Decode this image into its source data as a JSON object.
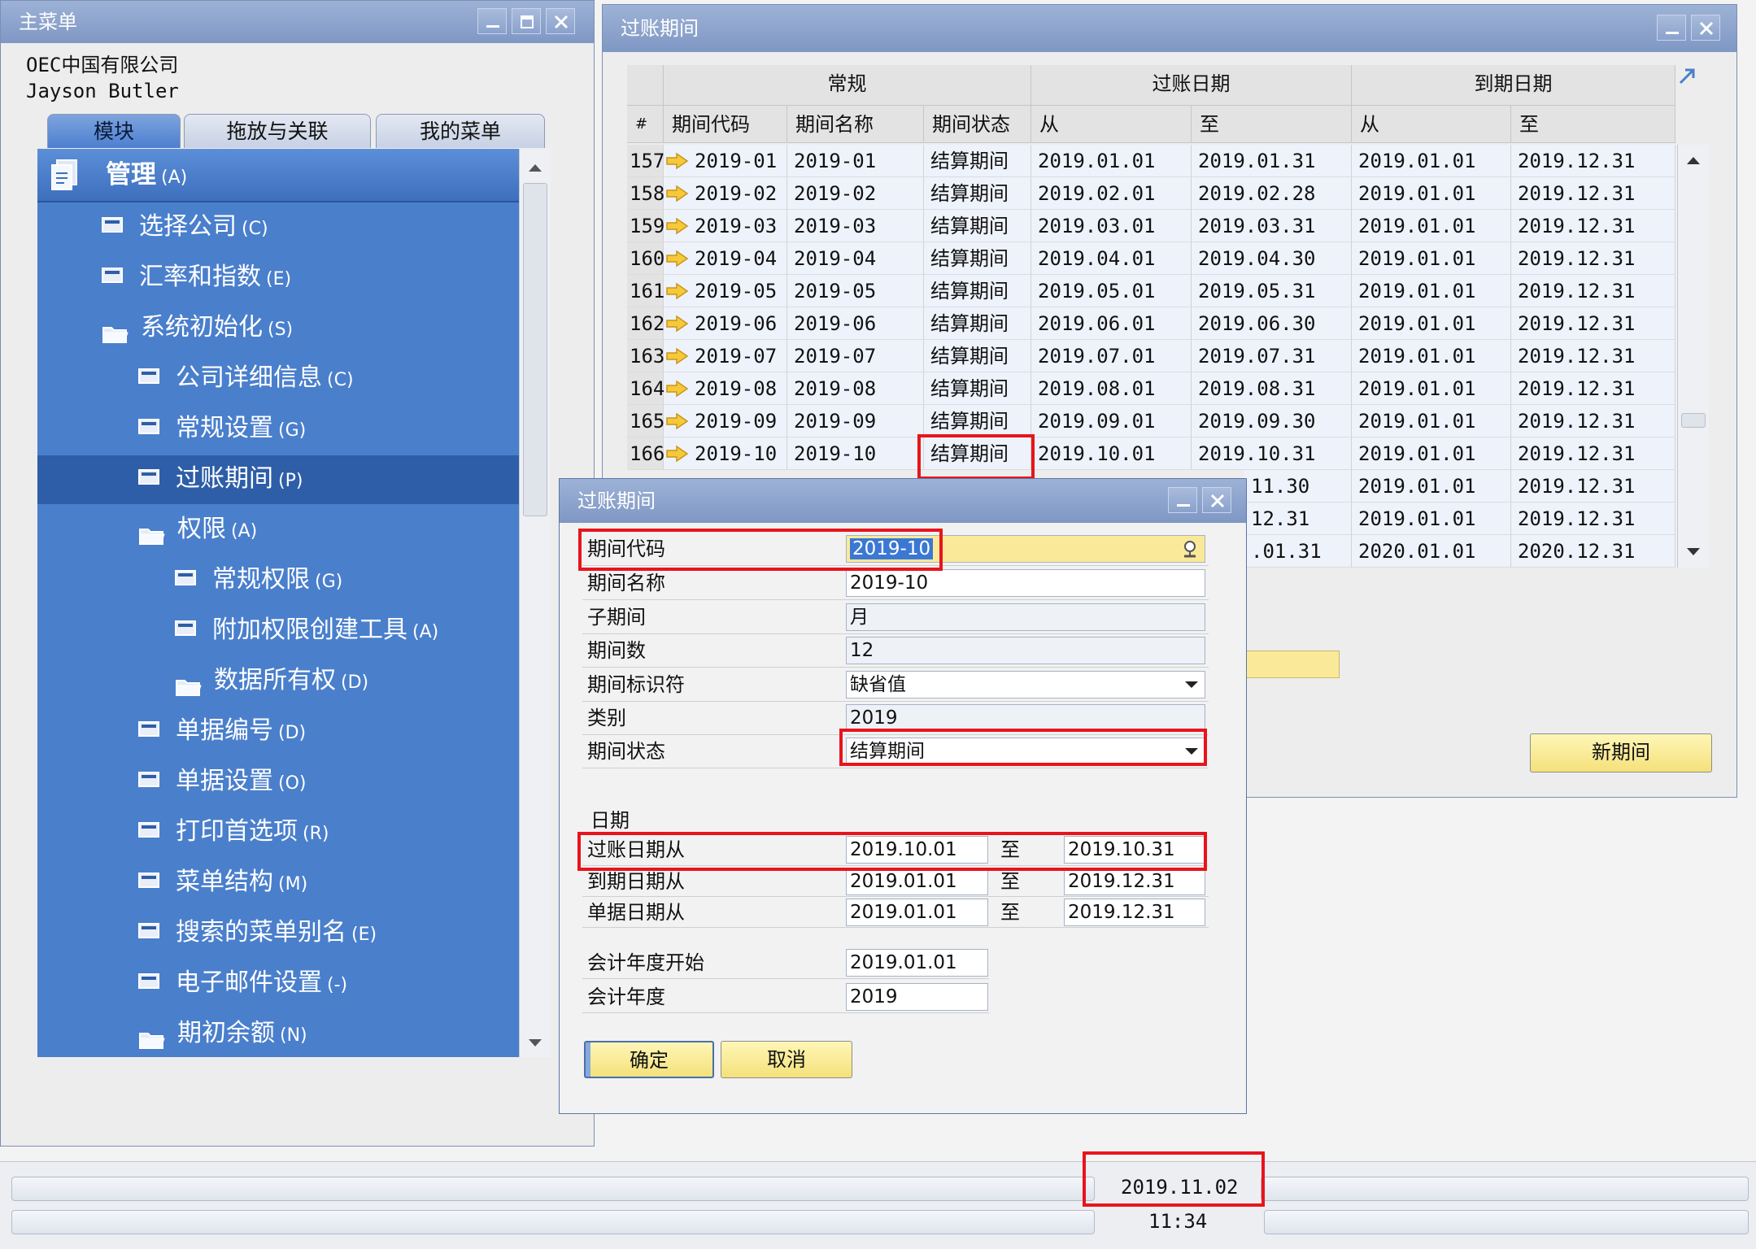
{
  "main_menu": {
    "title": "主菜单",
    "company": "OEC中国有限公司",
    "user": "Jayson Butler",
    "tabs": [
      "模块",
      "拖放与关联",
      "我的菜单"
    ],
    "section": {
      "label": "管理",
      "key": "(A)"
    },
    "items": [
      {
        "label": "选择公司",
        "key": "(C)"
      },
      {
        "label": "汇率和指数",
        "key": "(E)"
      },
      {
        "label": "系统初始化",
        "key": "(S)"
      },
      {
        "label": "公司详细信息",
        "key": "(C)"
      },
      {
        "label": "常规设置",
        "key": "(G)"
      },
      {
        "label": "过账期间",
        "key": "(P)"
      },
      {
        "label": "权限",
        "key": "(A)"
      },
      {
        "label": "常规权限",
        "key": "(G)"
      },
      {
        "label": "附加权限创建工具",
        "key": "(A)"
      },
      {
        "label": "数据所有权",
        "key": "(D)"
      },
      {
        "label": "单据编号",
        "key": "(D)"
      },
      {
        "label": "单据设置",
        "key": "(O)"
      },
      {
        "label": "打印首选项",
        "key": "(R)"
      },
      {
        "label": "菜单结构",
        "key": "(M)"
      },
      {
        "label": "搜索的菜单别名",
        "key": "(E)"
      },
      {
        "label": "电子邮件设置",
        "key": "(-)"
      },
      {
        "label": "期初余额",
        "key": "(N)"
      }
    ]
  },
  "periods_window": {
    "title": "过账期间",
    "groups": [
      "常规",
      "过账日期",
      "到期日期"
    ],
    "columns": [
      "#",
      "期间代码",
      "期间名称",
      "期间状态",
      "从",
      "至",
      "从",
      "至"
    ],
    "rows": [
      [
        "157",
        "2019-01",
        "2019-01",
        "结算期间",
        "2019.01.01",
        "2019.01.31",
        "2019.01.01",
        "2019.12.31"
      ],
      [
        "158",
        "2019-02",
        "2019-02",
        "结算期间",
        "2019.02.01",
        "2019.02.28",
        "2019.01.01",
        "2019.12.31"
      ],
      [
        "159",
        "2019-03",
        "2019-03",
        "结算期间",
        "2019.03.01",
        "2019.03.31",
        "2019.01.01",
        "2019.12.31"
      ],
      [
        "160",
        "2019-04",
        "2019-04",
        "结算期间",
        "2019.04.01",
        "2019.04.30",
        "2019.01.01",
        "2019.12.31"
      ],
      [
        "161",
        "2019-05",
        "2019-05",
        "结算期间",
        "2019.05.01",
        "2019.05.31",
        "2019.01.01",
        "2019.12.31"
      ],
      [
        "162",
        "2019-06",
        "2019-06",
        "结算期间",
        "2019.06.01",
        "2019.06.30",
        "2019.01.01",
        "2019.12.31"
      ],
      [
        "163",
        "2019-07",
        "2019-07",
        "结算期间",
        "2019.07.01",
        "2019.07.31",
        "2019.01.01",
        "2019.12.31"
      ],
      [
        "164",
        "2019-08",
        "2019-08",
        "结算期间",
        "2019.08.01",
        "2019.08.31",
        "2019.01.01",
        "2019.12.31"
      ],
      [
        "165",
        "2019-09",
        "2019-09",
        "结算期间",
        "2019.09.01",
        "2019.09.30",
        "2019.01.01",
        "2019.12.31"
      ],
      [
        "166",
        "2019-10",
        "2019-10",
        "结算期间",
        "2019.10.01",
        "2019.10.31",
        "2019.01.01",
        "2019.12.31"
      ]
    ],
    "partial_rows": [
      {
        "to": "11.30",
        "due_from": "2019.01.01",
        "due_to": "2019.12.31"
      },
      {
        "to": "12.31",
        "due_from": "2019.01.01",
        "due_to": "2019.12.31"
      },
      {
        "to": ".01.31",
        "due_from": "2020.01.01",
        "due_to": "2020.12.31"
      }
    ],
    "new_period_button": "新期间"
  },
  "dialog": {
    "title": "过账期间",
    "labels": {
      "code": "期间代码",
      "name": "期间名称",
      "sub": "子期间",
      "count": "期间数",
      "indicator": "期间标识符",
      "category": "类别",
      "status": "期间状态",
      "dates": "日期",
      "posting_from": "过账日期从",
      "due_from": "到期日期从",
      "doc_from": "单据日期从",
      "to": "至",
      "fy_start": "会计年度开始",
      "fy": "会计年度"
    },
    "values": {
      "code": "2019-10",
      "name": "2019-10",
      "sub": "月",
      "count": "12",
      "indicator": "缺省值",
      "category": "2019",
      "status": "结算期间",
      "posting_from": "2019.10.01",
      "posting_to": "2019.10.31",
      "due_from": "2019.01.01",
      "due_to": "2019.12.31",
      "doc_from": "2019.01.01",
      "doc_to": "2019.12.31",
      "fy_start": "2019.01.01",
      "fy": "2019"
    },
    "ok": "确定",
    "cancel": "取消"
  },
  "status": {
    "date": "2019.11.02",
    "time": "11:34"
  },
  "colors": {
    "accent": "#4a7fcc",
    "highlight": "#e8141c",
    "button_yellow": "#f4e17b"
  },
  "icons": [
    "minimize-icon",
    "maximize-icon",
    "close-icon",
    "document-icon",
    "folder-icon",
    "arrow-right-icon",
    "search-icon",
    "dropdown-icon"
  ]
}
